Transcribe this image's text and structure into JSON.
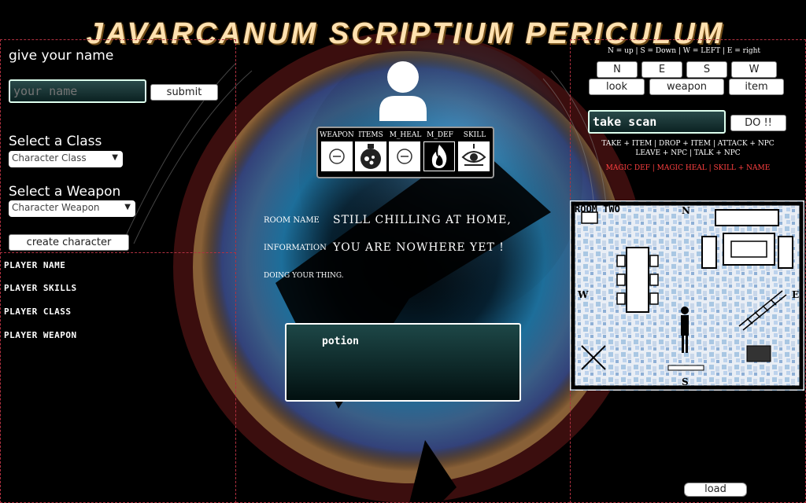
{
  "title": "Javarcanum Scriptium Periculum",
  "left": {
    "name_label": "give your name",
    "name_placeholder": "your name",
    "submit_label": "submit",
    "class_label": "Select a Class",
    "class_select": "Character Class",
    "weapon_label": "Select a Weapon",
    "weapon_select": "Character Weapon",
    "create_label": "create character",
    "stats": [
      "PLAYER NAME",
      "PLAYER SKILLS",
      "PLAYER CLASS",
      "PLAYER WEAPON"
    ]
  },
  "center": {
    "slots": [
      {
        "label": "WEAPON",
        "icon": "minus-circle-icon"
      },
      {
        "label": "ITEMS",
        "icon": "potion-flask-icon"
      },
      {
        "label": "M_HEAL",
        "icon": "minus-circle-icon"
      },
      {
        "label": "M_DEF",
        "icon": "fire-icon"
      },
      {
        "label": "SKILL",
        "icon": "eye-skill-icon"
      }
    ],
    "room_name_label": "ROOM NAME",
    "room_name_value": "STILL CHILLING AT HOME,",
    "information_label": "INFORMATION",
    "information_value": "YOU ARE NOWHERE YET !",
    "status_text": "DOING YOUR THING.",
    "output_text": "potion"
  },
  "right": {
    "direction_help": "N = up | S = Down | W = LEFT | E = right",
    "dir_buttons": [
      "N",
      "E",
      "S",
      "W"
    ],
    "action_buttons": [
      "look",
      "weapon",
      "item"
    ],
    "command_value": "take scan",
    "do_label": "DO !!",
    "help_line1": "TAKE + ITEM | DROP + ITEM | ATTACK + NPC",
    "help_line2": "LEAVE + NPC | TALK + NPC",
    "help_line3": "MAGIC DEF | MAGIC HEAL | SKILL + NAME",
    "map_room_label": "ROOM TWO",
    "map_compass": {
      "n": "N",
      "e": "E",
      "s": "S",
      "w": "W"
    },
    "load_label": "load"
  },
  "colors": {
    "accent_red": "#ff4040",
    "input_teal": "#0b2222",
    "title_gold": "#ffe1b0"
  }
}
